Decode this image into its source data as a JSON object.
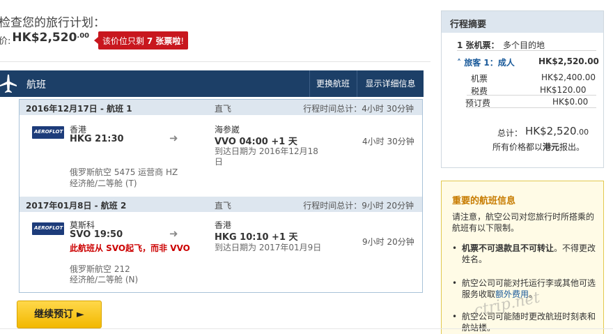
{
  "header": {
    "title": "检查您的旅行计划：",
    "price_label": "价:",
    "price": "HK$2,520",
    "price_cents": ".00",
    "seats_prefix": "该价位只剩",
    "seats_count": "7 张票啦",
    "seats_suffix": "!"
  },
  "flight_bar": {
    "title": "航班",
    "change_button": "更换航班",
    "details_button": "显示详细信息"
  },
  "segments": [
    {
      "date": "2016年12月17日 - 航班 1",
      "nonstop": "直飞",
      "total": "行程时间总计：4小时 30分钟",
      "airline_logo": "AEROFLOT",
      "dep_city": "香港",
      "dep_time": "HKG 21:30",
      "arr_city": "海参崴",
      "arr_time": "VVO 04:00 +1 天",
      "arr_date": "到达日期为 2016年12月18日",
      "duration": "4小时 30分钟",
      "carrier": "俄罗斯航空 5475 运营商 HZ",
      "cabin": "经济舱/二等舱 (T)"
    },
    {
      "date": "2017年01月8日 - 航班 2",
      "nonstop": "直飞",
      "total": "行程时间总计：9小时 20分钟",
      "airline_logo": "AEROFLOT",
      "dep_city": "莫斯科",
      "dep_time": "SVO 19:50",
      "warning": "此航班从 SVO起飞，而非 VVO",
      "arr_city": "香港",
      "arr_time": "HKG 10:10 +1 天",
      "arr_date": "到达日期为 2017年01月9日",
      "duration": "9小时 20分钟",
      "carrier": "俄罗斯航空 212",
      "cabin": "经济舱/二等舱 (N)"
    }
  ],
  "continue_button": "继续预订 ►",
  "summary": {
    "title": "行程摘要",
    "ticket_count": "1 张机票：",
    "ticket_type": "多个目的地",
    "traveler": "旅客 1：成人",
    "traveler_total": "HK$2,520.00",
    "fare_label": "机票",
    "fare": "HK$2,400.00",
    "tax_label": "税费",
    "tax": "HK$120.00",
    "fee_label": "预订费",
    "fee": "HK$0.00",
    "total_label": "总计：",
    "total": "HK$2,520",
    "total_cents": ".00",
    "currency_note_prefix": "所有价格都以",
    "currency_note_bold": "港元",
    "currency_note_suffix": "报出。"
  },
  "info": {
    "title": "重要的航班信息",
    "intro": "请注意，航空公司对您旅行时所搭乘的航班有以下限制。",
    "bullet1_bold": "机票不可退款且不可转让",
    "bullet1_rest": "。不得更改姓名。",
    "bullet2_prefix": "航空公司可能对托运行李或其他可选服务收取",
    "bullet2_link": "额外费用",
    "bullet2_suffix": "。",
    "bullet3": "航空公司可能随时更改航班时刻表和航站楼。"
  },
  "watermark": "ctrip.net"
}
